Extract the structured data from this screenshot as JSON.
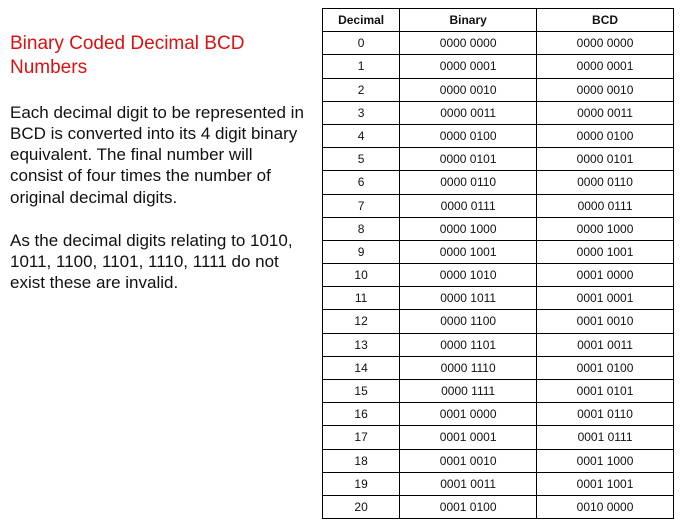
{
  "title": "Binary Coded Decimal BCD Numbers",
  "para1": "Each decimal digit to be represented in BCD is converted into its 4 digit binary equivalent. The final number will consist of four times the number of original decimal digits.",
  "para2": "As the decimal digits relating to 1010, 1011, 1100, 1101, 1110, 1111 do not exist these are invalid.",
  "table": {
    "headers": {
      "decimal": "Decimal",
      "binary": "Binary",
      "bcd": "BCD"
    },
    "rows": [
      {
        "decimal": "0",
        "binary": "0000 0000",
        "bcd": "0000 0000"
      },
      {
        "decimal": "1",
        "binary": "0000 0001",
        "bcd": "0000 0001"
      },
      {
        "decimal": "2",
        "binary": "0000 0010",
        "bcd": "0000 0010"
      },
      {
        "decimal": "3",
        "binary": "0000 0011",
        "bcd": "0000 0011"
      },
      {
        "decimal": "4",
        "binary": "0000 0100",
        "bcd": "0000 0100"
      },
      {
        "decimal": "5",
        "binary": "0000 0101",
        "bcd": "0000 0101"
      },
      {
        "decimal": "6",
        "binary": "0000 0110",
        "bcd": "0000 0110"
      },
      {
        "decimal": "7",
        "binary": "0000 0111",
        "bcd": "0000 0111"
      },
      {
        "decimal": "8",
        "binary": "0000 1000",
        "bcd": "0000 1000"
      },
      {
        "decimal": "9",
        "binary": "0000 1001",
        "bcd": "0000 1001"
      },
      {
        "decimal": "10",
        "binary": "0000 1010",
        "bcd": "0001 0000"
      },
      {
        "decimal": "11",
        "binary": "0000 1011",
        "bcd": "0001 0001"
      },
      {
        "decimal": "12",
        "binary": "0000 1100",
        "bcd": "0001 0010"
      },
      {
        "decimal": "13",
        "binary": "0000 1101",
        "bcd": "0001 0011"
      },
      {
        "decimal": "14",
        "binary": "0000 1110",
        "bcd": "0001 0100"
      },
      {
        "decimal": "15",
        "binary": "0000 1111",
        "bcd": "0001 0101"
      },
      {
        "decimal": "16",
        "binary": "0001 0000",
        "bcd": "0001 0110"
      },
      {
        "decimal": "17",
        "binary": "0001 0001",
        "bcd": "0001 0111"
      },
      {
        "decimal": "18",
        "binary": "0001 0010",
        "bcd": "0001 1000"
      },
      {
        "decimal": "19",
        "binary": "0001 0011",
        "bcd": "0001 1001"
      },
      {
        "decimal": "20",
        "binary": "0001 0100",
        "bcd": "0010 0000"
      }
    ]
  },
  "chart_data": {
    "type": "table",
    "title": "Decimal / Binary / BCD comparison",
    "columns": [
      "Decimal",
      "Binary",
      "BCD"
    ],
    "rows": [
      [
        "0",
        "0000 0000",
        "0000 0000"
      ],
      [
        "1",
        "0000 0001",
        "0000 0001"
      ],
      [
        "2",
        "0000 0010",
        "0000 0010"
      ],
      [
        "3",
        "0000 0011",
        "0000 0011"
      ],
      [
        "4",
        "0000 0100",
        "0000 0100"
      ],
      [
        "5",
        "0000 0101",
        "0000 0101"
      ],
      [
        "6",
        "0000 0110",
        "0000 0110"
      ],
      [
        "7",
        "0000 0111",
        "0000 0111"
      ],
      [
        "8",
        "0000 1000",
        "0000 1000"
      ],
      [
        "9",
        "0000 1001",
        "0000 1001"
      ],
      [
        "10",
        "0000 1010",
        "0001 0000"
      ],
      [
        "11",
        "0000 1011",
        "0001 0001"
      ],
      [
        "12",
        "0000 1100",
        "0001 0010"
      ],
      [
        "13",
        "0000 1101",
        "0001 0011"
      ],
      [
        "14",
        "0000 1110",
        "0001 0100"
      ],
      [
        "15",
        "0000 1111",
        "0001 0101"
      ],
      [
        "16",
        "0001 0000",
        "0001 0110"
      ],
      [
        "17",
        "0001 0001",
        "0001 0111"
      ],
      [
        "18",
        "0001 0010",
        "0001 1000"
      ],
      [
        "19",
        "0001 0011",
        "0001 1001"
      ],
      [
        "20",
        "0001 0100",
        "0010 0000"
      ]
    ]
  }
}
